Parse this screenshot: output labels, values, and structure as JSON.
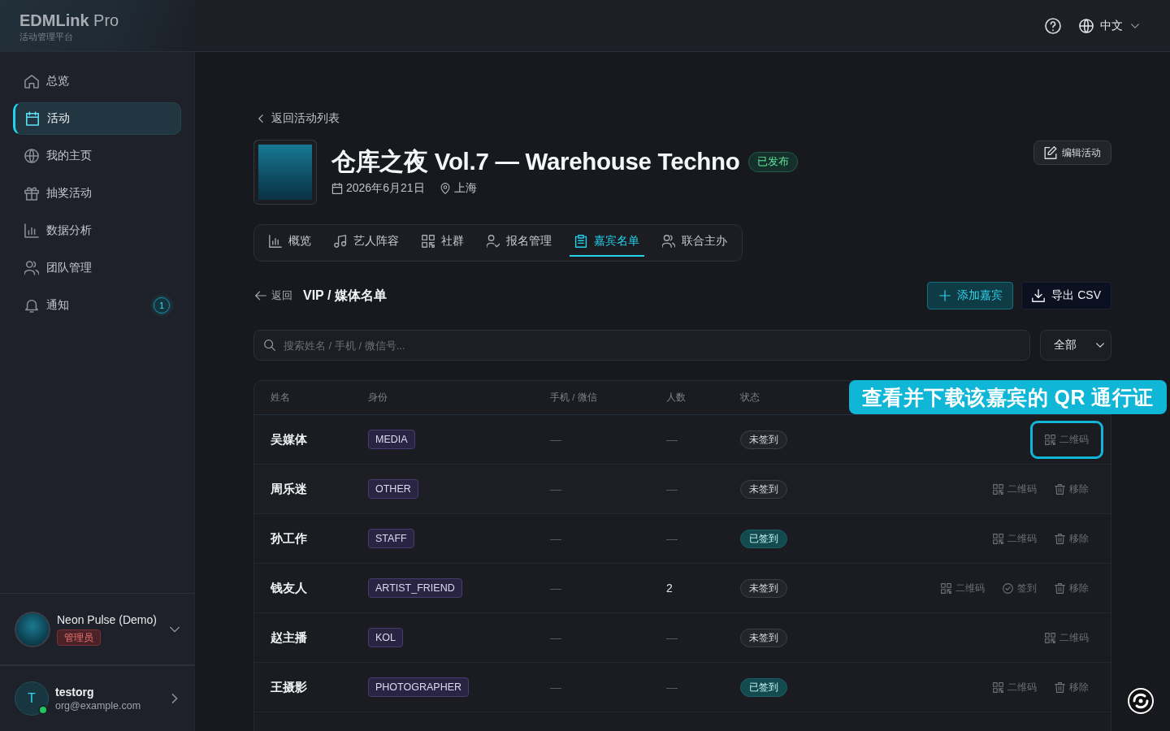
{
  "brand": {
    "name": "**EDMLink** Pro",
    "subtitle": "活动管理平台"
  },
  "topbar": {
    "language": "中文"
  },
  "sidebar": {
    "items": [
      {
        "label": "总览",
        "selected": false
      },
      {
        "label": "活动",
        "selected": true
      },
      {
        "label": "我的主页",
        "selected": false
      },
      {
        "label": "抽奖活动",
        "selected": false
      },
      {
        "label": "数据分析",
        "selected": false
      },
      {
        "label": "团队管理",
        "selected": false
      },
      {
        "label": "通知",
        "selected": false,
        "badge": "1"
      }
    ],
    "org": {
      "name": "Neon Pulse (Demo)",
      "role": "管理员"
    },
    "user": {
      "initial": "T",
      "name": "testorg",
      "email": "org@example.com",
      "online": true
    }
  },
  "event": {
    "back_link": "返回活动列表",
    "title": "仓库之夜 Vol.7 — Warehouse Techno",
    "status": "已发布",
    "date": "2026年6月21日",
    "location": "上海",
    "edit_button": "编辑活动"
  },
  "tabs": [
    {
      "label": "概览",
      "selected": false
    },
    {
      "label": "艺人阵容",
      "selected": false
    },
    {
      "label": "社群",
      "selected": false
    },
    {
      "label": "报名管理",
      "selected": false
    },
    {
      "label": "嘉宾名单",
      "selected": true
    },
    {
      "label": "联合主办",
      "selected": false
    }
  ],
  "guest_list": {
    "back": "返回",
    "title": "VIP / 媒体名单",
    "add_button": "添加嘉宾",
    "export_button": "导出 CSV",
    "search": {
      "placeholder": "搜索姓名 / 手机 / 微信号..."
    },
    "filter": "全部",
    "table": {
      "columns": [
        "姓名",
        "身份",
        "手机 / 微信",
        "人数",
        "状态"
      ],
      "rows": [
        {
          "name": "吴媒体",
          "role": "MEDIA",
          "contact": "—",
          "count": "—",
          "status": "未签到",
          "checked_in": false,
          "actions": [
            {
              "kind": "qr",
              "label": "二维码",
              "highlighted": true
            }
          ]
        },
        {
          "name": "周乐迷",
          "role": "OTHER",
          "contact": "—",
          "count": "—",
          "status": "未签到",
          "checked_in": false,
          "actions": [
            {
              "kind": "qr",
              "label": "二维码",
              "highlighted": false
            },
            {
              "kind": "remove",
              "label": "移除",
              "highlighted": false
            }
          ]
        },
        {
          "name": "孙工作",
          "role": "STAFF",
          "contact": "—",
          "count": "—",
          "status": "已签到",
          "checked_in": true,
          "actions": [
            {
              "kind": "qr",
              "label": "二维码",
              "highlighted": false
            },
            {
              "kind": "remove",
              "label": "移除",
              "highlighted": false
            }
          ]
        },
        {
          "name": "钱友人",
          "role": "ARTIST_FRIEND",
          "contact": "—",
          "count": "2",
          "status": "未签到",
          "checked_in": false,
          "actions": [
            {
              "kind": "qr",
              "label": "二维码",
              "highlighted": false
            },
            {
              "kind": "checkin",
              "label": "签到",
              "highlighted": false
            },
            {
              "kind": "remove",
              "label": "移除",
              "highlighted": false
            }
          ]
        },
        {
          "name": "赵主播",
          "role": "KOL",
          "contact": "—",
          "count": "—",
          "status": "未签到",
          "checked_in": false,
          "actions": [
            {
              "kind": "qr",
              "label": "二维码",
              "highlighted": false
            }
          ]
        },
        {
          "name": "王摄影",
          "role": "PHOTOGRAPHER",
          "contact": "—",
          "count": "—",
          "status": "已签到",
          "checked_in": true,
          "actions": [
            {
              "kind": "qr",
              "label": "二维码",
              "highlighted": false
            },
            {
              "kind": "remove",
              "label": "移除",
              "highlighted": false
            }
          ]
        }
      ]
    }
  },
  "callout": {
    "text": "查看并下载该嘉宾的 QR 通行证"
  }
}
